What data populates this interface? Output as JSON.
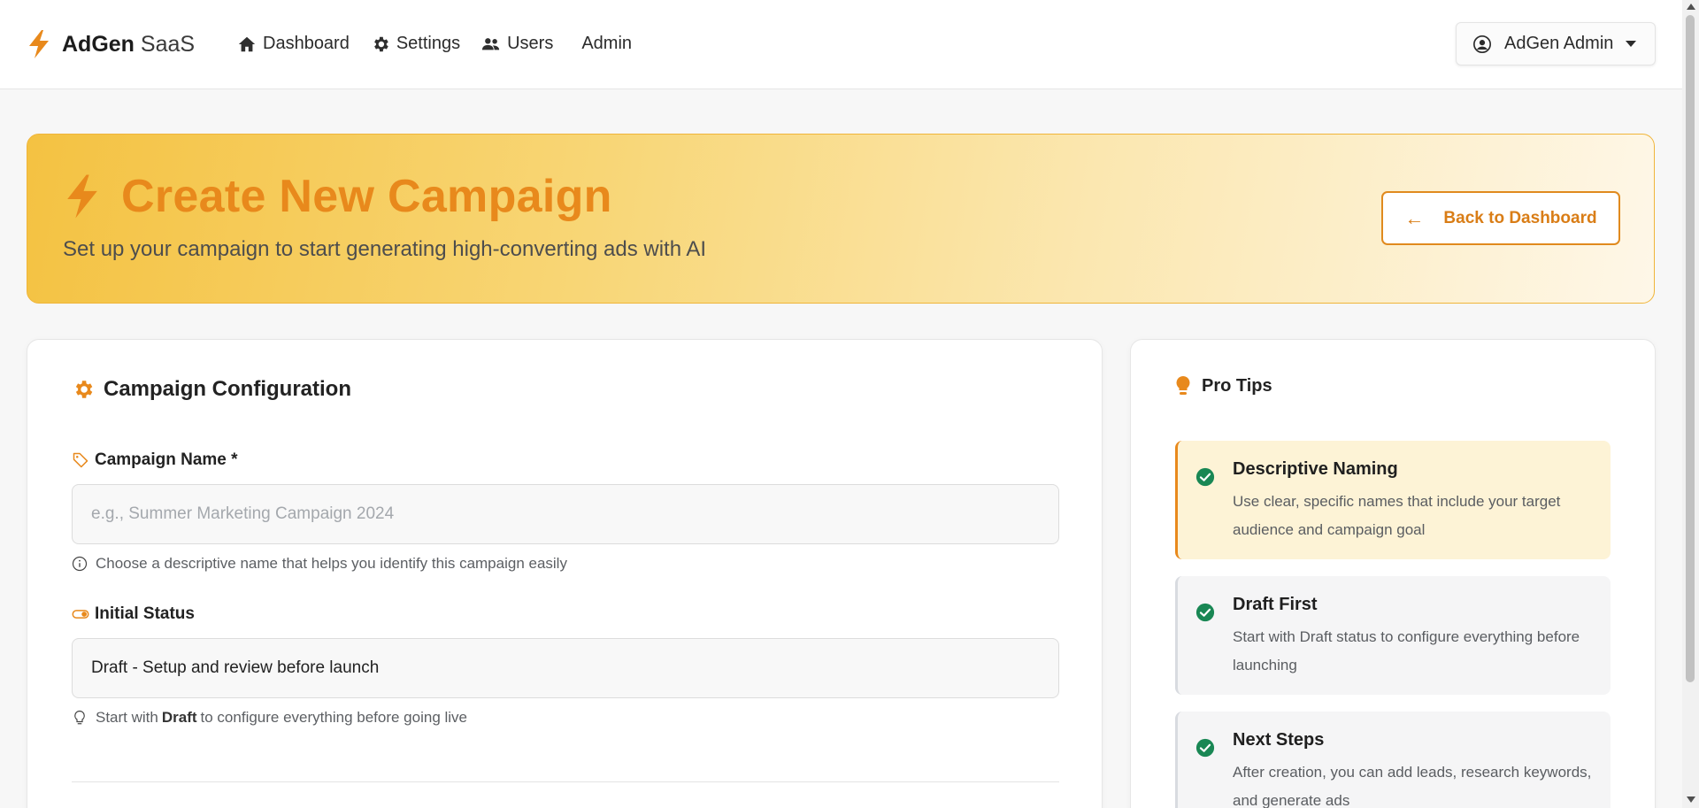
{
  "navbar": {
    "brand_bold": "AdGen",
    "brand_light": "SaaS",
    "links": [
      {
        "label": "Dashboard",
        "icon": "home-icon"
      },
      {
        "label": "Settings",
        "icon": "gear-icon"
      },
      {
        "label": "Users",
        "icon": "users-icon"
      },
      {
        "label": "Admin",
        "icon": ""
      }
    ],
    "user_menu_label": "AdGen Admin"
  },
  "hero": {
    "title": "Create New Campaign",
    "subtitle": "Set up your campaign to start generating high-converting ads with AI",
    "back_button_label": "Back to Dashboard",
    "back_button_arrow": "←"
  },
  "config": {
    "title": "Campaign Configuration",
    "campaign_name": {
      "label": "Campaign Name *",
      "placeholder": "e.g., Summer Marketing Campaign 2024",
      "value": "",
      "help": "Choose a descriptive name that helps you identify this campaign easily"
    },
    "initial_status": {
      "label": "Initial Status",
      "selected": "Draft - Setup and review before launch",
      "help_prefix": "Start with",
      "help_bold": "Draft",
      "help_suffix": "to configure everything before going live"
    }
  },
  "tips": {
    "title": "Pro Tips",
    "items": [
      {
        "title": "Descriptive Naming",
        "desc": "Use clear, specific names that include your target audience and campaign goal"
      },
      {
        "title": "Draft First",
        "desc": "Start with Draft status to configure everything before launching"
      },
      {
        "title": "Next Steps",
        "desc": "After creation, you can add leads, research keywords, and generate ads"
      }
    ]
  },
  "colors": {
    "accent": "#e8891c",
    "hero_gradient_start": "#f4c242",
    "tip_active_bg": "#fdf3d6",
    "check_green": "#198754"
  }
}
